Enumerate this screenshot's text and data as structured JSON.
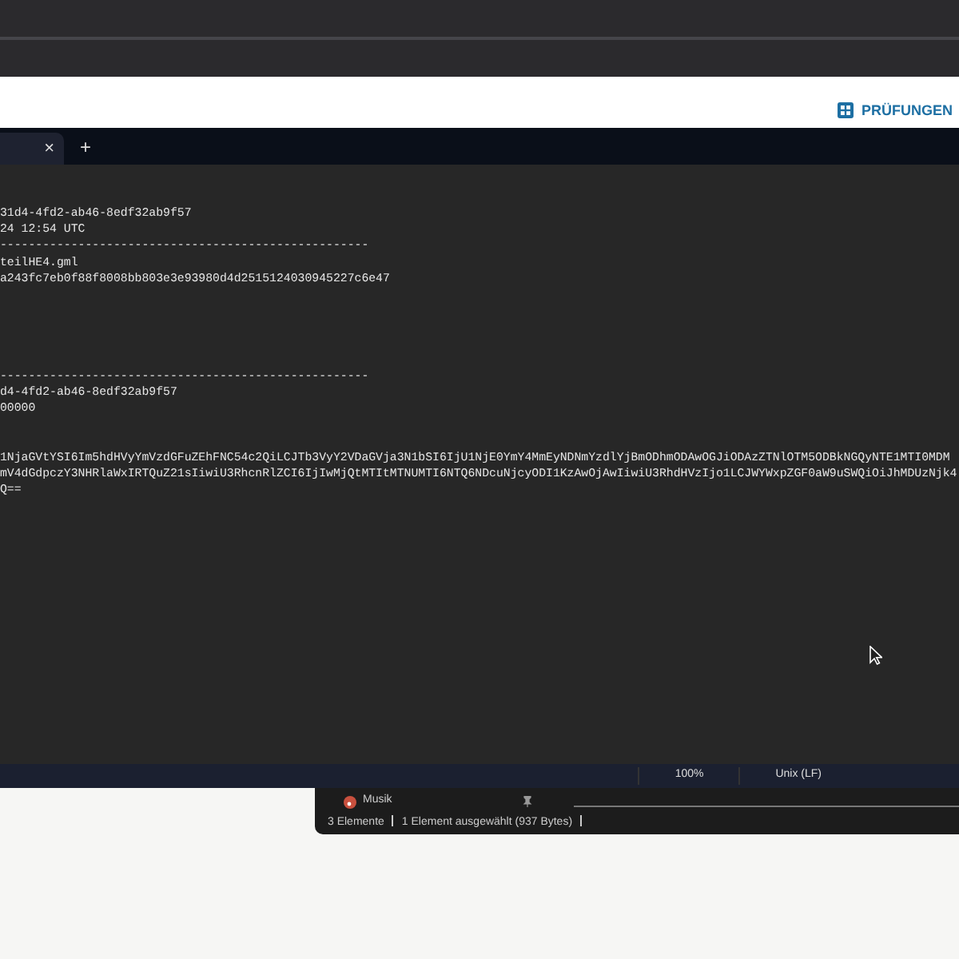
{
  "header": {
    "button": "PRÜFUNGEN"
  },
  "editor": {
    "tabs": [
      {
        "selected": true
      }
    ],
    "new_tab": "+",
    "close": "×",
    "lines": [
      {
        "kind": "text",
        "text": "31d4-4fd2-ab46-8edf32ab9f57"
      },
      {
        "kind": "text",
        "text": "24 12:54 UTC"
      },
      {
        "kind": "text",
        "text": "----------------------------------------------------"
      },
      {
        "kind": "text",
        "text": "teilHE4.gml"
      },
      {
        "kind": "text",
        "text": "a243fc7eb0f88f8008bb803e3e93980d4d2515124030945227c6e47"
      },
      {
        "kind": "blank"
      },
      {
        "kind": "blank"
      },
      {
        "kind": "blank"
      },
      {
        "kind": "blank"
      },
      {
        "kind": "blank"
      },
      {
        "kind": "text",
        "text": "----------------------------------------------------"
      },
      {
        "kind": "text",
        "text": "d4-4fd2-ab46-8edf32ab9f57"
      },
      {
        "kind": "text",
        "text": "00000"
      },
      {
        "kind": "blank"
      },
      {
        "kind": "blank"
      },
      {
        "kind": "text",
        "text": "1NjaGVtYSI6Im5hdHVyYmVzdGFuZEhFNC54c2QiLCJTb3VyY2VDaGVja3N1bSI6IjU1NjE0YmY4MmEyNDNmYzdlYjBmODhmODAwOGJiODAzZTNlOTM5ODBkNGQyNTE1MTI0MDM"
      },
      {
        "kind": "text",
        "text": "mV4dGdpczY3NHRlaWxIRTQuZ21sIiwiU3RhcnRlZCI6IjIwMjQtMTItMTNUMTI6NTQ6NDcuNjcyODI1KzAwOjAwIiwiU3RhdHVzIjo1LCJWYWxpZGF0aW9uSWQiOiJhMDUzNjk4"
      },
      {
        "kind": "text",
        "text": "Q=="
      }
    ],
    "status_bar": [
      "100%",
      "Unix (LF)"
    ]
  },
  "explorer": {
    "item": "Musik",
    "status_bar": [
      "3 Elemente",
      "1 Element ausgewählt (937 Bytes)"
    ]
  }
}
